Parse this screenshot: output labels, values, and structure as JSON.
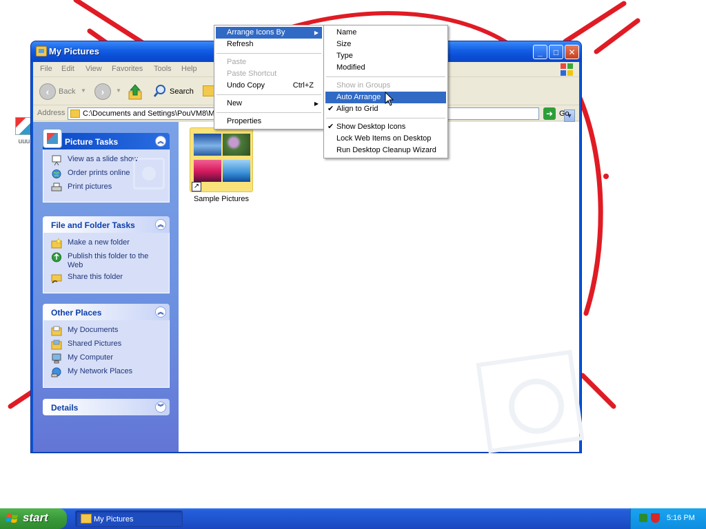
{
  "window": {
    "title": "My Pictures",
    "menu": [
      "File",
      "Edit",
      "View",
      "Favorites",
      "Tools",
      "Help"
    ],
    "toolbar": {
      "back_label": "Back",
      "search_label": "Search"
    },
    "address": {
      "label": "Address",
      "value": "C:\\Documents and Settings\\PouVM8\\My",
      "go_label": "Go"
    }
  },
  "task_pane": {
    "picture_tasks": {
      "title": "Picture Tasks",
      "items": [
        "View as a slide show",
        "Order prints online",
        "Print pictures"
      ]
    },
    "file_folder_tasks": {
      "title": "File and Folder Tasks",
      "items": [
        "Make a new folder",
        "Publish this folder to the Web",
        "Share this folder"
      ]
    },
    "other_places": {
      "title": "Other Places",
      "items": [
        "My Documents",
        "Shared Pictures",
        "My Computer",
        "My Network Places"
      ]
    },
    "details": {
      "title": "Details"
    }
  },
  "content": {
    "folder_label": "Sample Pictures"
  },
  "context_menu": {
    "items": [
      {
        "label": "Arrange Icons By",
        "state": "highlighted",
        "submenu": true
      },
      {
        "label": "Refresh",
        "state": "enabled"
      },
      {
        "label": "Paste",
        "state": "disabled"
      },
      {
        "label": "Paste Shortcut",
        "state": "disabled"
      },
      {
        "label": "Undo Copy",
        "state": "enabled",
        "shortcut": "Ctrl+Z"
      },
      {
        "label": "New",
        "state": "enabled",
        "submenu": true
      },
      {
        "label": "Properties",
        "state": "enabled"
      }
    ]
  },
  "arrange_submenu": {
    "items": [
      {
        "label": "Name",
        "state": "enabled"
      },
      {
        "label": "Size",
        "state": "enabled"
      },
      {
        "label": "Type",
        "state": "enabled"
      },
      {
        "label": "Modified",
        "state": "enabled"
      },
      {
        "label": "Show in Groups",
        "state": "disabled"
      },
      {
        "label": "Auto Arrange",
        "state": "highlighted"
      },
      {
        "label": "Align to Grid",
        "state": "checked"
      },
      {
        "label": "Show Desktop Icons",
        "state": "checked"
      },
      {
        "label": "Lock Web Items on Desktop",
        "state": "enabled"
      },
      {
        "label": "Run Desktop Cleanup Wizard",
        "state": "enabled"
      }
    ]
  },
  "desktop": {
    "icon_label": "uuu"
  },
  "taskbar": {
    "start_label": "start",
    "task_items": [
      "My Pictures"
    ],
    "clock": "5:16 PM"
  },
  "colors": {
    "titlebar": "#0b4fd6",
    "menu_highlight": "#316ac5",
    "taskpane_link": "#21347a",
    "start_green": "#3a9a3a",
    "annotation_red": "#e01b24"
  }
}
